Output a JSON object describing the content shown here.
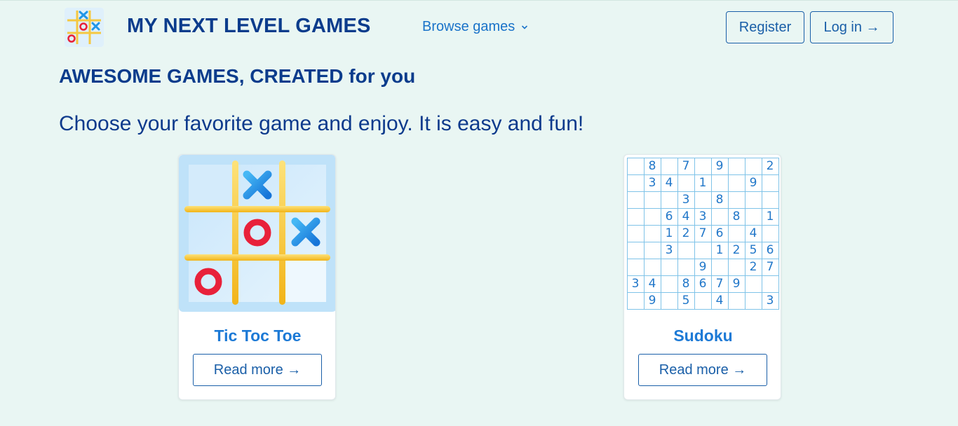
{
  "header": {
    "site_title": "MY NEXT LEVEL GAMES",
    "browse_label": "Browse games",
    "register_label": "Register",
    "login_label": "Log in →"
  },
  "hero": {
    "title": "AWESOME GAMES, CREATED for you",
    "subtitle": "Choose your favorite game and enjoy. It is easy and fun!"
  },
  "games": [
    {
      "title": "Tic Toc Toe",
      "read_more": "Read more →",
      "image_icon": "tic-tac-toe-board"
    },
    {
      "title": "Sudoku",
      "read_more": "Read more →",
      "image_icon": "sudoku-grid"
    }
  ],
  "sudoku_grid": [
    [
      "",
      "8",
      "",
      "7",
      "",
      "9",
      "",
      "",
      "2"
    ],
    [
      "",
      "3",
      "4",
      "",
      "1",
      "",
      "",
      "9",
      ""
    ],
    [
      "",
      "",
      "",
      "3",
      "",
      "8",
      "",
      "",
      ""
    ],
    [
      "",
      "",
      "6",
      "4",
      "3",
      "",
      "8",
      "",
      "1"
    ],
    [
      "",
      "",
      "1",
      "2",
      "7",
      "6",
      "",
      "4",
      ""
    ],
    [
      "",
      "",
      "3",
      "",
      "",
      "1",
      "2",
      "5",
      "6"
    ],
    [
      "",
      "",
      "",
      "",
      "9",
      "",
      "",
      "2",
      "7"
    ],
    [
      "3",
      "4",
      "",
      "8",
      "6",
      "7",
      "9",
      "",
      ""
    ],
    [
      "",
      "9",
      "",
      "5",
      "",
      "4",
      "",
      "",
      "3"
    ]
  ],
  "colors": {
    "background": "#e9f6f3",
    "brand_dark": "#0b3c8c",
    "link_blue": "#1a73c9",
    "x_blue": "#2196e8",
    "o_red": "#e8213a",
    "grid_yellow": "#f7c934"
  }
}
